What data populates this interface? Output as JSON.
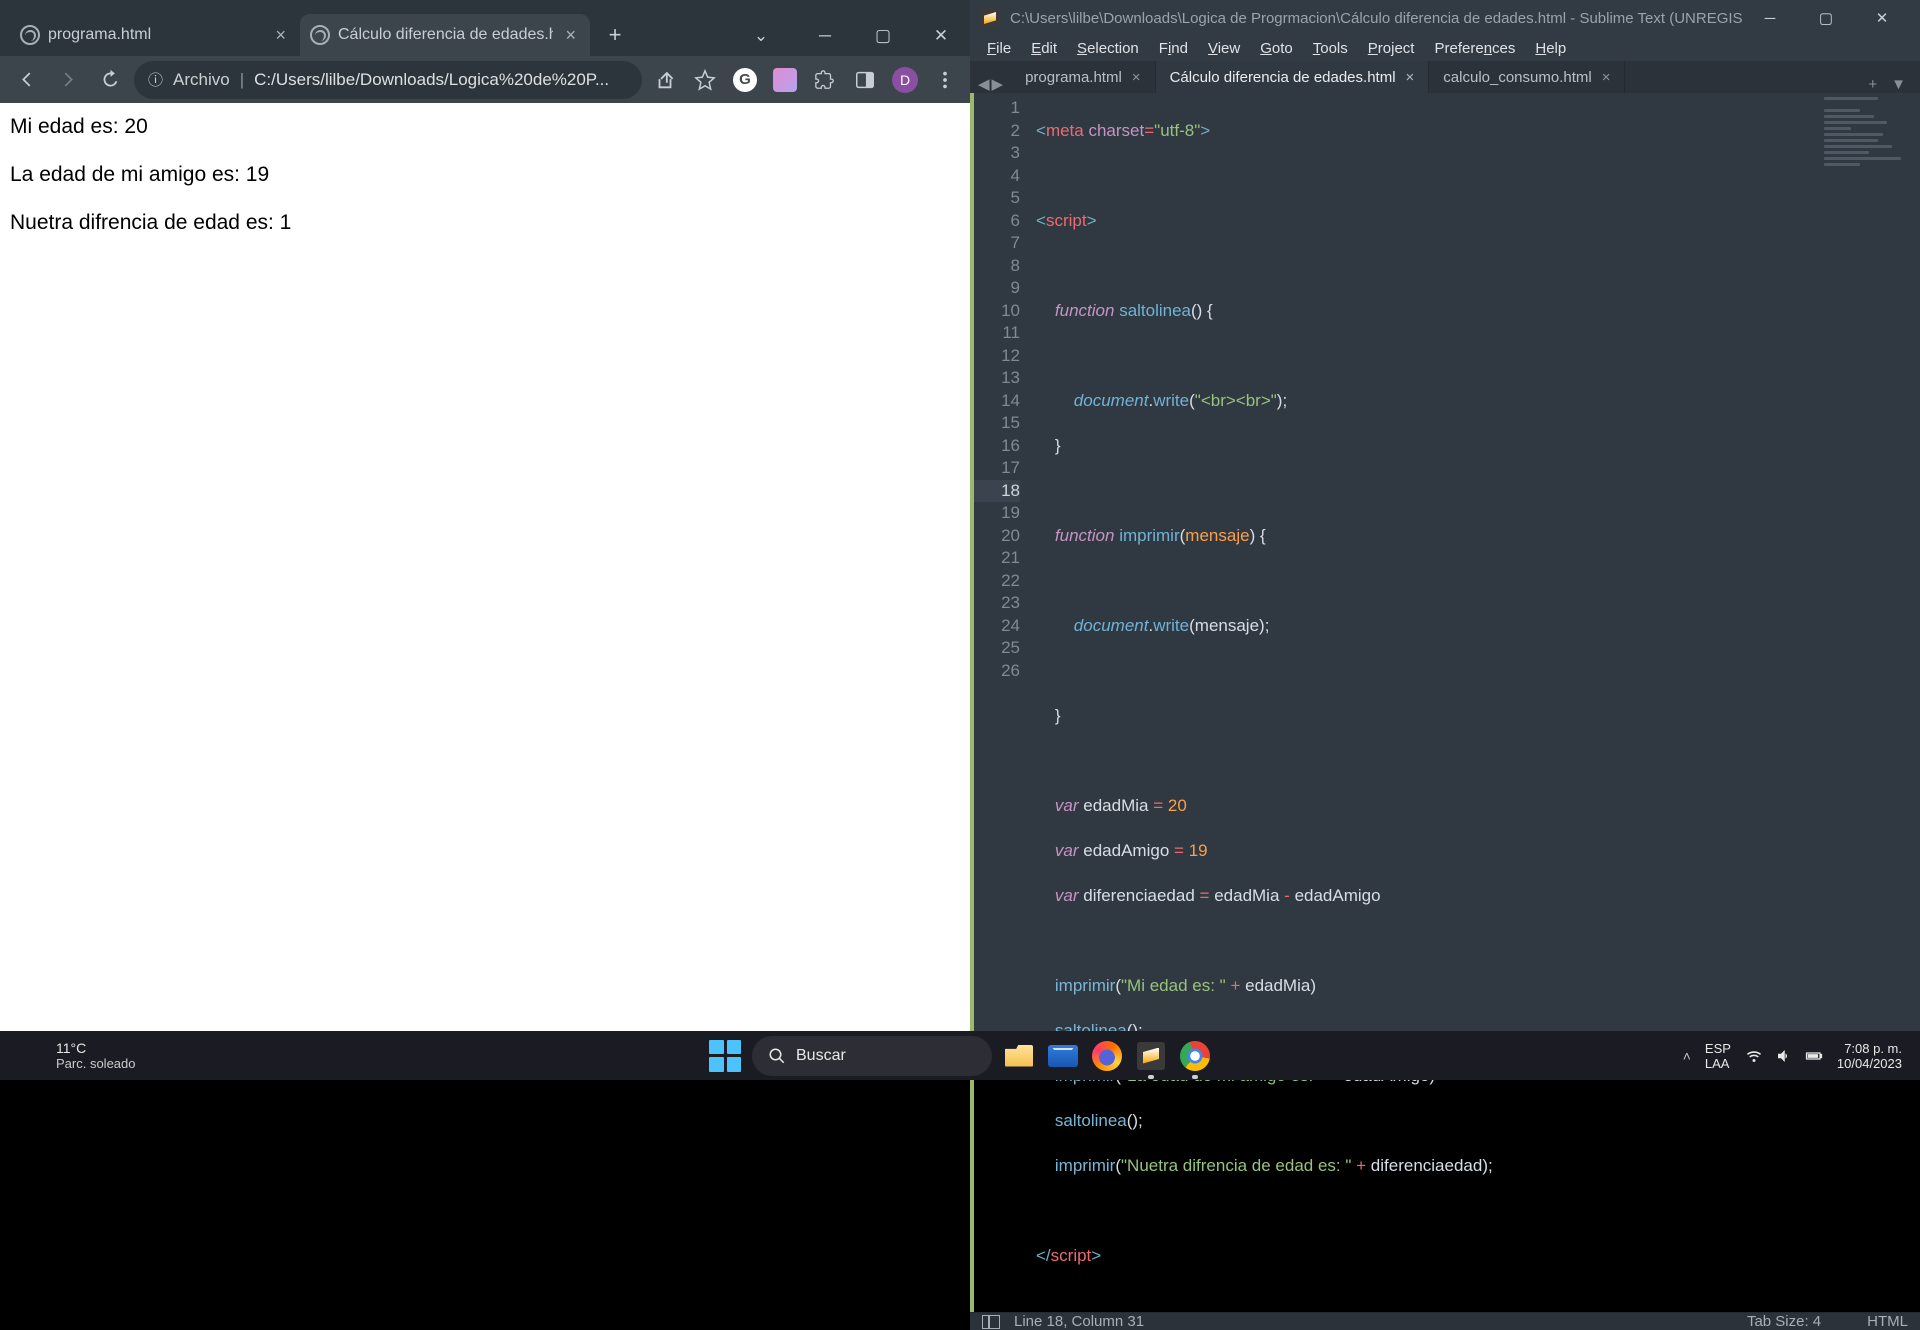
{
  "chrome": {
    "tabs": [
      {
        "title": "programa.html",
        "active": false
      },
      {
        "title": "Cálculo diferencia de edades.htm",
        "active": true
      }
    ],
    "url_prefix": "Archivo",
    "url": "C:/Users/lilbe/Downloads/Logica%20de%20P...",
    "avatar_letter": "D",
    "page_lines": [
      "Mi edad es: 20",
      "La edad de mi amigo es: 19",
      "Nuetra difrencia de edad es: 1"
    ]
  },
  "sublime": {
    "title_path": "C:\\Users\\lilbe\\Downloads\\Logica de Progrmacion\\Cálculo diferencia de edades.html - Sublime Text (UNREGIST...",
    "menu": [
      "File",
      "Edit",
      "Selection",
      "Find",
      "View",
      "Goto",
      "Tools",
      "Project",
      "Preferences",
      "Help"
    ],
    "tabs": [
      {
        "name": "programa.html",
        "active": false
      },
      {
        "name": "Cálculo diferencia de edades.html",
        "active": true
      },
      {
        "name": "calculo_consumo.html",
        "active": false
      }
    ],
    "active_line": 18,
    "status_left": "Line 18, Column 31",
    "status_tab": "Tab Size: 4",
    "status_lang": "HTML",
    "code_values": {
      "charset": "utf-8",
      "fn1": "saltolinea",
      "fn2": "imprimir",
      "param": "mensaje",
      "wr_str": "\"<br><br>\"",
      "var1": "edadMia",
      "val1": "20",
      "var2": "edadAmigo",
      "val2": "19",
      "var3": "diferenciaedad",
      "str1": "\"Mi edad es: \"",
      "str2": "\"La edad de mi amigo es: \"",
      "str3": "\"Nuetra difrencia de edad es: \""
    }
  },
  "taskbar": {
    "temp": "11°C",
    "weather": "Parc. soleado",
    "search": "Buscar",
    "lang1": "ESP",
    "lang2": "LAA",
    "time": "7:08 p. m.",
    "date": "10/04/2023"
  }
}
